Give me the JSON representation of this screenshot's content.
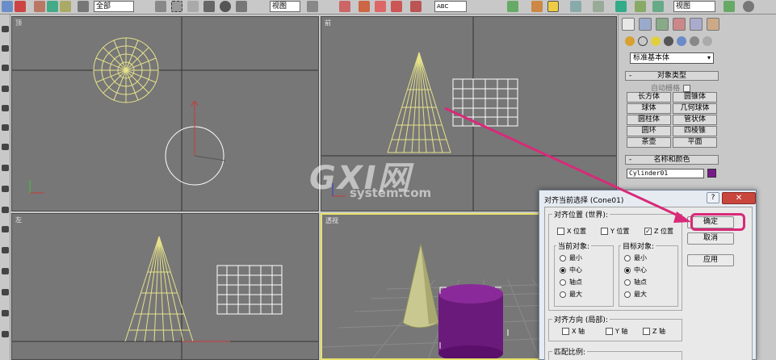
{
  "toolbar": {
    "selection_filter": "全部",
    "ref_coord": "视图",
    "named_selection": "ABC",
    "right_select": "视图"
  },
  "viewports": {
    "top": {
      "label": "顶"
    },
    "front": {
      "label": "前"
    },
    "left": {
      "label": "左"
    },
    "perspective": {
      "label": "透视"
    }
  },
  "command_panel": {
    "category": "标准基本体",
    "object_type_header": "对象类型",
    "auto_grid": "自动栅格",
    "objects": [
      "长方体",
      "圆锥体",
      "球体",
      "几何球体",
      "圆柱体",
      "管状体",
      "圆环",
      "四棱锥",
      "茶壶",
      "平面"
    ],
    "name_color_header": "名称和颜色",
    "object_name": "Cylinder01",
    "minus": "-"
  },
  "watermark": {
    "big": "GXI网",
    "small": "system.com"
  },
  "dialog": {
    "title": "对齐当前选择 (Cone01)",
    "help": "?",
    "close": "✕",
    "align_position_label": "对齐位置 (世界):",
    "x_position": "X 位置",
    "y_position": "Y 位置",
    "z_position": "Z 位置",
    "z_checked": "✓",
    "current_object_label": "当前对象:",
    "target_object_label": "目标对象:",
    "opt_min": "最小",
    "opt_center": "中心",
    "opt_pivot": "轴点",
    "opt_max": "最大",
    "orientation_label": "对齐方向 (局部):",
    "x_axis": "X 轴",
    "y_axis": "Y 轴",
    "z_axis": "Z 轴",
    "match_scale_label": "匹配比例:",
    "ok": "确定",
    "cancel": "取消",
    "apply": "应用"
  },
  "colors": {
    "wireframe": "#e6e28a",
    "cylinder": "#6a1a7a",
    "cone_shaded": "#c8c890",
    "arrow": "#d82a78",
    "close_button": "#c9463d"
  }
}
